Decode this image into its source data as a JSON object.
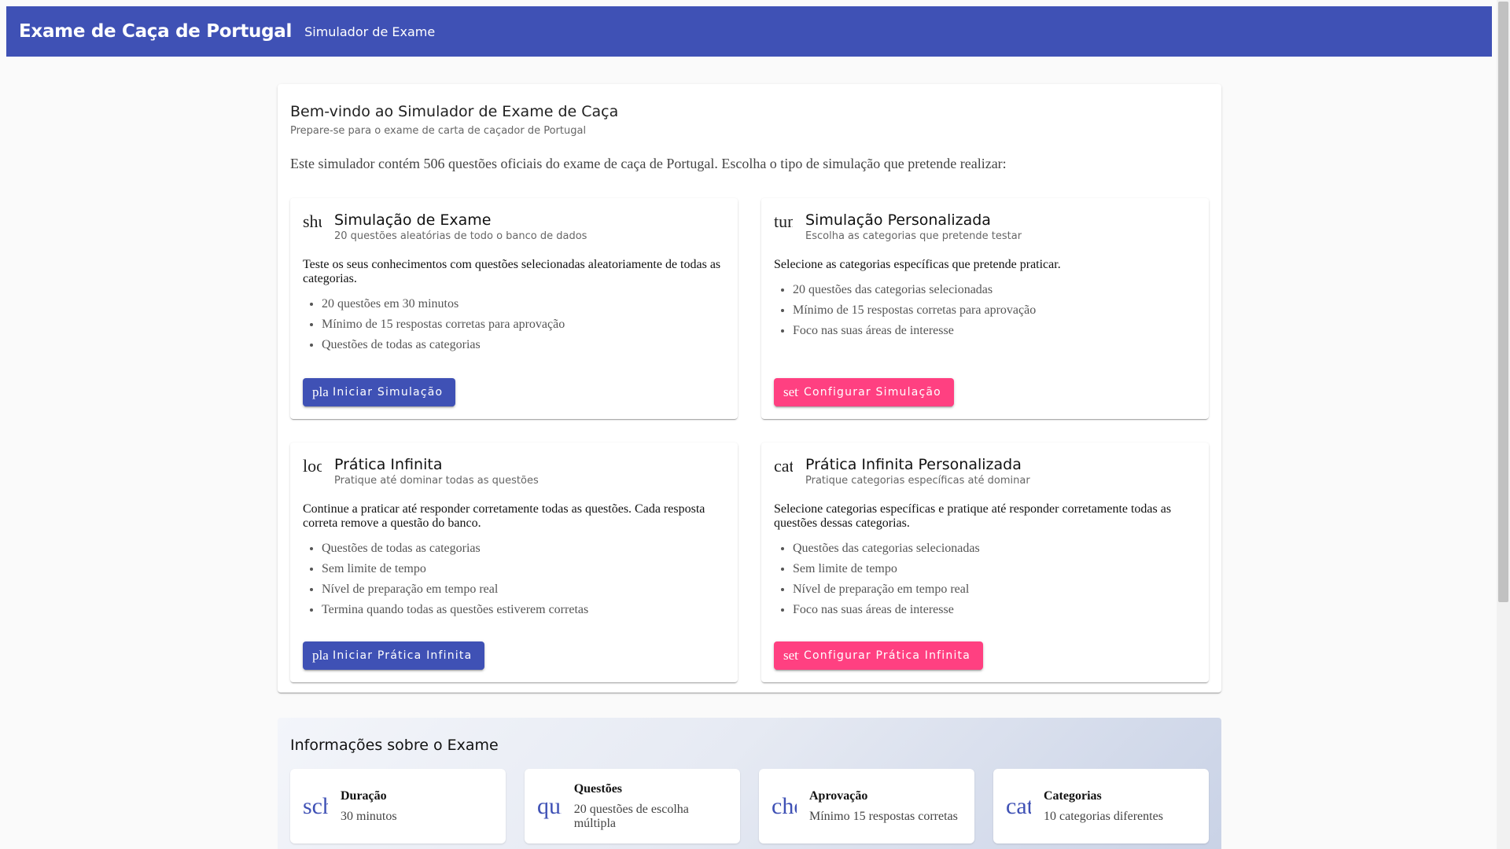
{
  "toolbar": {
    "title": "Exame de Caça de Portugal",
    "subtitle": "Simulador de Exame",
    "color": "#3f51b5"
  },
  "welcome": {
    "title": "Bem-vindo ao Simulador de Exame de Caça",
    "subtitle": "Prepare-se para o exame de carta de caçador de Portugal",
    "intro": "Este simulador contém 506 questões oficiais do exame de caça de Portugal. Escolha o tipo de simulação que pretende realizar:"
  },
  "modes": [
    {
      "icon_name": "shuffle-icon",
      "icon_text": "shuffle",
      "title": "Simulação de Exame",
      "subtitle": "20 questões aleatórias de todo o banco de dados",
      "description": "Teste os seus conhecimentos com questões selecionadas aleatoriamente de todas as categorias.",
      "features": [
        "20 questões em 30 minutos",
        "Mínimo de 15 respostas corretas para aprovação",
        "Questões de todas as categorias"
      ],
      "button": {
        "icon_name": "play-arrow-icon",
        "icon_text": "play_arrow",
        "label": "Iniciar Simulação",
        "color": "#3f51b5"
      }
    },
    {
      "icon_name": "tune-icon",
      "icon_text": "tune",
      "title": "Simulação Personalizada",
      "subtitle": "Escolha as categorias que pretende testar",
      "description": "Selecione as categorias específicas que pretende praticar.",
      "features": [
        "20 questões das categorias selecionadas",
        "Mínimo de 15 respostas corretas para aprovação",
        "Foco nas suas áreas de interesse"
      ],
      "button": {
        "icon_name": "settings-icon",
        "icon_text": "settings",
        "label": "Configurar Simulação",
        "color": "#ff4081"
      }
    },
    {
      "icon_name": "loop-icon",
      "icon_text": "loop",
      "title": "Prática Infinita",
      "subtitle": "Pratique até dominar todas as questões",
      "description": "Continue a praticar até responder corretamente todas as questões. Cada resposta correta remove a questão do banco.",
      "features": [
        "Questões de todas as categorias",
        "Sem limite de tempo",
        "Nível de preparação em tempo real",
        "Termina quando todas as questões estiverem corretas"
      ],
      "button": {
        "icon_name": "play-arrow-icon",
        "icon_text": "play_arrow",
        "label": "Iniciar Prática Infinita",
        "color": "#3f51b5"
      }
    },
    {
      "icon_name": "category-icon",
      "icon_text": "category",
      "title": "Prática Infinita Personalizada",
      "subtitle": "Pratique categorias específicas até dominar",
      "description": "Selecione categorias específicas e pratique até responder corretamente todas as questões dessas categorias.",
      "features": [
        "Questões das categorias selecionadas",
        "Sem limite de tempo",
        "Nível de preparação em tempo real",
        "Foco nas suas áreas de interesse"
      ],
      "button": {
        "icon_name": "settings-icon",
        "icon_text": "settings",
        "label": "Configurar Prática Infinita",
        "color": "#ff4081"
      }
    }
  ],
  "info": {
    "title": "Informações sobre o Exame",
    "items": [
      {
        "icon_name": "schedule-icon",
        "icon_text": "schedule",
        "label": "Duração",
        "value": "30 minutos"
      },
      {
        "icon_name": "quiz-icon",
        "icon_text": "quiz",
        "label": "Questões",
        "value": "20 questões de escolha múltipla"
      },
      {
        "icon_name": "check-circle-icon",
        "icon_text": "check_circle",
        "label": "Aprovação",
        "value": "Mínimo 15 respostas corretas"
      },
      {
        "icon_name": "category-icon",
        "icon_text": "category",
        "label": "Categorias",
        "value": "10 categorias diferentes"
      }
    ]
  }
}
